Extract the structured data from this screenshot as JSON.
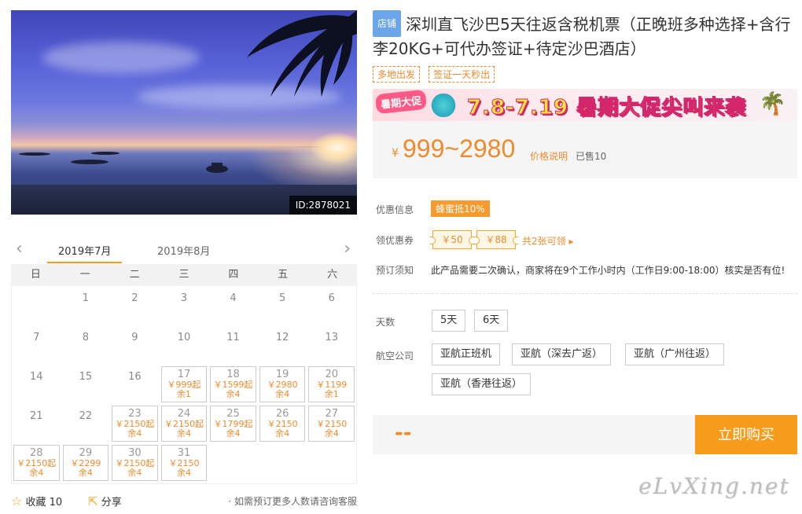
{
  "hero": {
    "id_tag": "ID:2878021"
  },
  "title": {
    "badge": "店铺",
    "text": "深圳直飞沙巴5天往返含税机票（正晚班多种选择+含行李20KG+可代办签证+待定沙巴酒店）"
  },
  "tags": [
    "多地出发",
    "签证一天秒出"
  ],
  "banner": {
    "left": "暑期大促",
    "main": "7.8-7.19 暑期大促尖叫来袭"
  },
  "price": {
    "symbol": "¥",
    "range": "999~2980",
    "desc": "价格说明",
    "sold": "已售10"
  },
  "promo": {
    "label": "优惠信息",
    "value": "蜂蜜抵10%"
  },
  "coupons": {
    "label": "领优惠券",
    "items": [
      "￥50",
      "￥88"
    ],
    "more": "共2张可领 ▸"
  },
  "notice": {
    "label": "预订须知",
    "text": "此产品需要二次确认，商家将在9个工作小时内（工作日9:00-18:00）核实是否有位!"
  },
  "days": {
    "label": "天数",
    "options": [
      "5天",
      "6天"
    ]
  },
  "airlines": {
    "label": "航空公司",
    "options": [
      "亚航正班机",
      "亚航（深去广返）",
      "亚航（广州往返）",
      "亚航（香港往返）"
    ]
  },
  "buy": {
    "qty": "--",
    "button": "立即购买"
  },
  "watermark": "eLvXing.net",
  "calendar": {
    "months": [
      "2019年7月",
      "2019年8月"
    ],
    "weekdays": [
      "日",
      "一",
      "二",
      "三",
      "四",
      "五",
      "六"
    ],
    "days": [
      {
        "d": ""
      },
      {
        "d": "1"
      },
      {
        "d": "2"
      },
      {
        "d": "3"
      },
      {
        "d": "4"
      },
      {
        "d": "5"
      },
      {
        "d": "6"
      },
      {
        "d": "7"
      },
      {
        "d": "8"
      },
      {
        "d": "9"
      },
      {
        "d": "10"
      },
      {
        "d": "11"
      },
      {
        "d": "12"
      },
      {
        "d": "13"
      },
      {
        "d": "14"
      },
      {
        "d": "15"
      },
      {
        "d": "16"
      },
      {
        "d": "17",
        "p": "￥999起",
        "r": "余1"
      },
      {
        "d": "18",
        "p": "￥1599起",
        "r": "余4"
      },
      {
        "d": "19",
        "p": "￥2980",
        "r": "余4"
      },
      {
        "d": "20",
        "p": "￥1199",
        "r": "余1"
      },
      {
        "d": "21"
      },
      {
        "d": "22"
      },
      {
        "d": "23",
        "p": "￥2150起",
        "r": "余4"
      },
      {
        "d": "24",
        "p": "￥2150起",
        "r": "余4"
      },
      {
        "d": "25",
        "p": "￥1799起",
        "r": "余4"
      },
      {
        "d": "26",
        "p": "￥2150",
        "r": "余4"
      },
      {
        "d": "27",
        "p": "￥2150",
        "r": "余4"
      },
      {
        "d": "28",
        "p": "￥2150起",
        "r": "余4"
      },
      {
        "d": "29",
        "p": "￥2299",
        "r": "余4"
      },
      {
        "d": "30",
        "p": "￥2150起",
        "r": "余4"
      },
      {
        "d": "31",
        "p": "￥2150",
        "r": "余4"
      }
    ]
  },
  "footer": {
    "fav": "收藏 10",
    "share": "分享",
    "tip": "· 如需预订更多人数请咨询客服"
  }
}
